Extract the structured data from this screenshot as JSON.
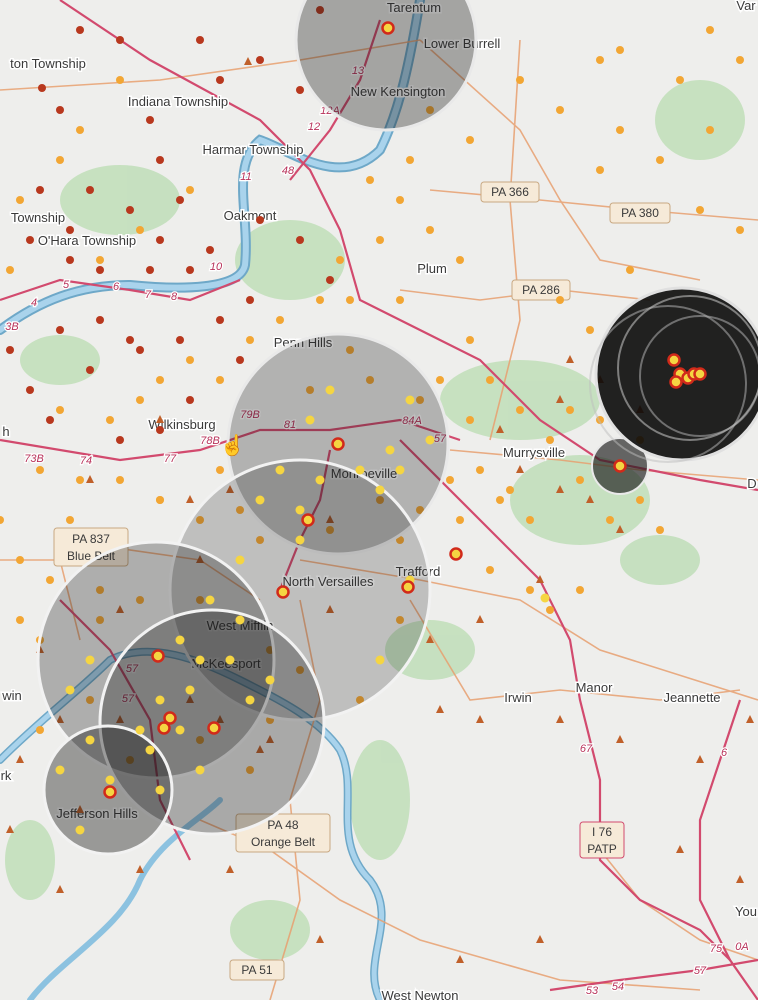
{
  "map": {
    "places": {
      "tarentum": "Tarentum",
      "lower_burrell": "Lower Burrell",
      "new_kensington": "New Kensington",
      "indiana_township": "Indiana Township",
      "harmar_township": "Harmar Township",
      "oakmont": "Oakmont",
      "township_left": "Township",
      "ohara_township": "O'Hara Township",
      "ton_township": "ton Township",
      "plum": "Plum",
      "penn_hills": "Penn Hills",
      "wilkinsburg": "Wilkinsburg",
      "monroeville": "Monroeville",
      "murrysville": "Murrysville",
      "north_versailles": "North Versailles",
      "trafford": "Trafford",
      "west_mifflin": "West Mifflin",
      "mckeesport": "McKeesport",
      "jefferson_hills": "Jefferson Hills",
      "irwin": "Irwin",
      "manor": "Manor",
      "jeannette": "Jeannette",
      "west_newton": "West Newton",
      "you": "You",
      "var": "Var",
      "d_right": "D",
      "win_left": "win",
      "rk_left": "rk",
      "h_left": "h"
    },
    "shields": {
      "pa366": "PA 366",
      "pa380": "PA 380",
      "pa286": "PA 286",
      "pa837": "PA 837",
      "blue_belt": "Blue Belt",
      "pa48": "PA 48",
      "orange_belt": "Orange Belt",
      "pa51": "PA 51",
      "i76": "I 76",
      "patp": "PATP"
    },
    "exits": {
      "e13": "13",
      "e12a": "12A",
      "e12": "12",
      "e11": "11",
      "e48": "48",
      "e10": "10",
      "e8": "8",
      "e7": "7",
      "e6": "6",
      "e5": "5",
      "e4": "4",
      "e3b": "3B",
      "e79b": "79B",
      "e81": "81",
      "e84a": "84A",
      "e57": "57",
      "e78b": "78B",
      "e73b": "73B",
      "e74": "74",
      "e77": "77",
      "e57b": "57",
      "e57c": "57",
      "e67": "67",
      "e6b": "6",
      "e75": "75",
      "e0a": "0A",
      "e54": "54",
      "e53": "53",
      "e57d": "57"
    },
    "colors": {
      "land": "#eeeeec",
      "forest": "#a8d5a0",
      "water": "#8cc2e0",
      "river_edge": "#6ea8c8",
      "major_road": "#d24a6e",
      "minor_road": "#e8a070",
      "circle_fill": "#1a1a1a",
      "dot_orange": "#f2a634",
      "dot_red": "#d12a1a",
      "dot_yellow": "#f5d542",
      "triangle": "#c0602a"
    }
  }
}
